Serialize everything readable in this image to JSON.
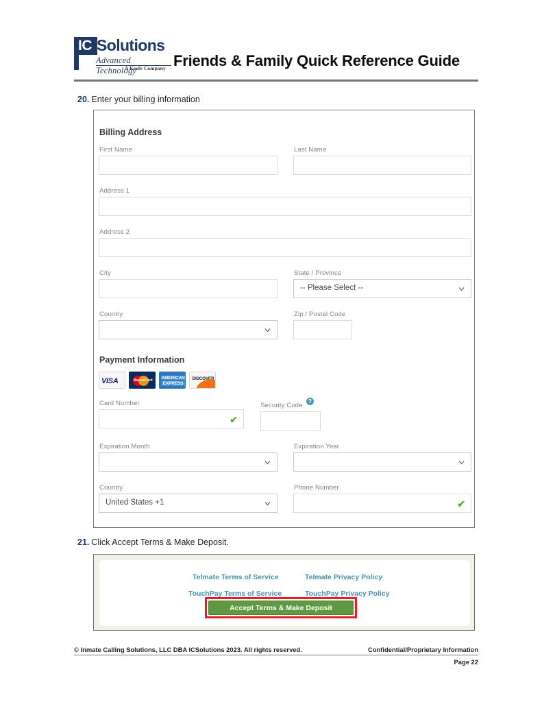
{
  "header": {
    "logo": {
      "ic": "IC",
      "solutions": "Solutions",
      "tagline": "Advanced Technology",
      "company": "A Keefe Company"
    },
    "title": "Friends & Family Quick Reference Guide"
  },
  "steps": {
    "step20": {
      "number": "20.",
      "text": "Enter your billing information"
    },
    "step21": {
      "number": "21.",
      "text": "Click Accept Terms & Make Deposit."
    }
  },
  "billing": {
    "section_title": "Billing Address",
    "fields": {
      "first_name": {
        "label": "First Name",
        "value": ""
      },
      "last_name": {
        "label": "Last Name",
        "value": ""
      },
      "address1": {
        "label": "Address 1",
        "value": ""
      },
      "address2": {
        "label": "Address 2",
        "value": ""
      },
      "city": {
        "label": "City",
        "value": ""
      },
      "state": {
        "label": "State / Province",
        "value": "-- Please Select --"
      },
      "country": {
        "label": "Country",
        "value": ""
      },
      "zip": {
        "label": "Zip / Postal Code",
        "value": ""
      }
    }
  },
  "payment": {
    "section_title": "Payment Information",
    "cards": [
      {
        "name": "visa-card-logo",
        "label": "VISA"
      },
      {
        "name": "mastercard-card-logo",
        "label": "MasterCard"
      },
      {
        "name": "amex-card-logo",
        "label_line1": "AMERICAN",
        "label_line2": "EXPRESS"
      },
      {
        "name": "discover-card-logo",
        "label": "DISCOVER"
      }
    ],
    "fields": {
      "card_number": {
        "label": "Card Number",
        "value": "",
        "valid": "✔"
      },
      "security_code": {
        "label": "Security Code",
        "value": "",
        "help": "?"
      },
      "exp_month": {
        "label": "Expiration Month",
        "value": ""
      },
      "exp_year": {
        "label": "Expiration Year",
        "value": ""
      },
      "country": {
        "label": "Country",
        "value": "United States +1"
      },
      "phone": {
        "label": "Phone Number",
        "value": "",
        "valid": "✔"
      }
    }
  },
  "terms": {
    "links": [
      {
        "label": "Telmate Terms of Service"
      },
      {
        "label": "Telmate Privacy Policy"
      },
      {
        "label": "TouchPay Terms of Service"
      },
      {
        "label": "TouchPay Privacy Policy"
      }
    ],
    "accept_button": "Accept Terms & Make Deposit"
  },
  "footer": {
    "copyright": "© Inmate Calling Solutions, LLC DBA ICSolutions 2023. All rights reserved.",
    "confidential": "Confidential/Proprietary Information",
    "page": "Page 22"
  },
  "colors": {
    "brand_navy": "#1f3864",
    "link_teal": "#4a92b0",
    "accept_green": "#5f9a41",
    "highlight_red": "#ed1c24",
    "valid_green": "#5aa832",
    "label_gray": "#8c8279"
  }
}
